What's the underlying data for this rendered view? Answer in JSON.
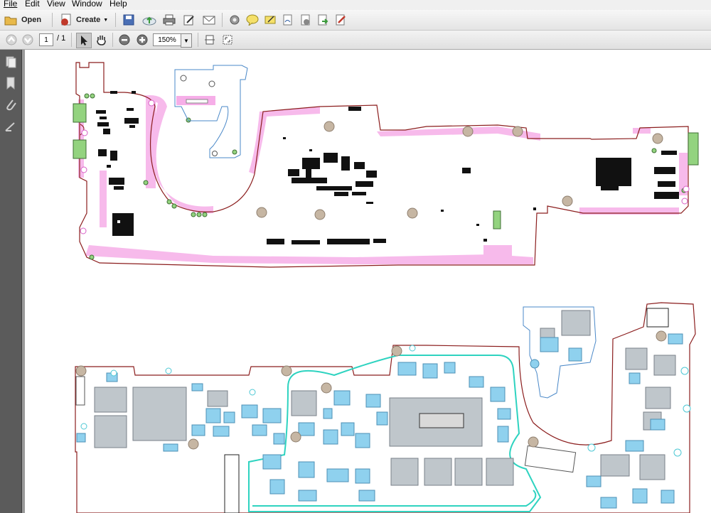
{
  "menu": [
    "File",
    "Edit",
    "View",
    "Window",
    "Help"
  ],
  "toolbar": {
    "open_label": "Open",
    "create_label": "Create"
  },
  "navigation": {
    "page_current": "1",
    "page_total": "/ 1",
    "zoom": "150%"
  },
  "icons": {
    "open": "folder-icon",
    "create": "create-pdf-icon",
    "save": "save-icon",
    "upload": "cloud-upload-icon",
    "print": "printer-icon",
    "edit": "edit-icon",
    "email": "envelope-icon"
  },
  "colors": {
    "board_outline": "#8b1d1d",
    "keepout": "#f2a3e6",
    "mounting_hole": "#c8b8a0",
    "connector": "#8fcf7f",
    "bottom_trace": "#34d3c1",
    "bottom_fill": "#8fd1ee"
  }
}
